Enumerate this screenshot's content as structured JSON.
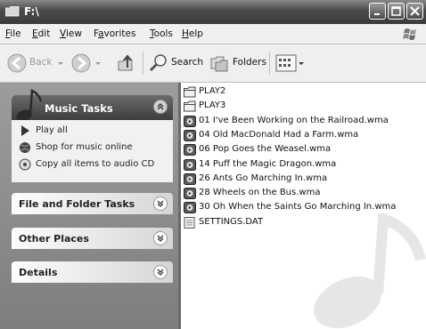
{
  "window": {
    "title": "F:\\"
  },
  "menu": [
    {
      "pre": "",
      "ul": "F",
      "post": "ile"
    },
    {
      "pre": "",
      "ul": "E",
      "post": "dit"
    },
    {
      "pre": "",
      "ul": "V",
      "post": "iew"
    },
    {
      "pre": "F",
      "ul": "a",
      "post": "vorites"
    },
    {
      "pre": "",
      "ul": "T",
      "post": "ools"
    },
    {
      "pre": "",
      "ul": "H",
      "post": "elp"
    }
  ],
  "toolbar": {
    "back": "Back",
    "search": "Search",
    "folders": "Folders"
  },
  "music_tasks": {
    "title": "Music Tasks",
    "items": [
      "Play all",
      "Shop for music online",
      "Copy all items to audio CD"
    ]
  },
  "panels": {
    "file_folder": "File and Folder Tasks",
    "other_places": "Other Places",
    "details": "Details"
  },
  "files": [
    {
      "name": "PLAY2",
      "type": "folder"
    },
    {
      "name": "PLAY3",
      "type": "folder"
    },
    {
      "name": "01 I've Been Working on the Railroad.wma",
      "type": "wma"
    },
    {
      "name": "04 Old MacDonald Had a Farm.wma",
      "type": "wma"
    },
    {
      "name": "06 Pop Goes the Weasel.wma",
      "type": "wma"
    },
    {
      "name": "14 Puff the Magic Dragon.wma",
      "type": "wma"
    },
    {
      "name": "26 Ants Go Marching In.wma",
      "type": "wma"
    },
    {
      "name": "28 Wheels on the Bus.wma",
      "type": "wma"
    },
    {
      "name": "30 Oh When the Saints Go Marching In.wma",
      "type": "wma"
    },
    {
      "name": "SETTINGS.DAT",
      "type": "dat"
    }
  ]
}
